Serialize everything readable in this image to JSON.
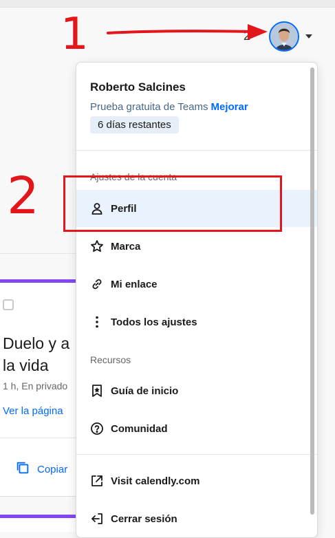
{
  "header": {
    "count_label": "2",
    "avatar_alt": "Roberto Salcines"
  },
  "annotations": {
    "step1": "1",
    "step2": "2"
  },
  "event_card": {
    "title": "Duelo y a\nla vida",
    "meta": "1 h, En privado",
    "view_link": "Ver la página",
    "copy_label": "Copiar"
  },
  "menu": {
    "user_name": "Roberto Salcines",
    "trial_text": "Prueba gratuita de Teams",
    "upgrade_label": "Mejorar",
    "days_left": "6 días restantes",
    "account_section": "Ajustes de la cuenta",
    "items": [
      {
        "label": "Perfil",
        "icon": "person-icon"
      },
      {
        "label": "Marca",
        "icon": "star-icon"
      },
      {
        "label": "Mi enlace",
        "icon": "link-icon"
      },
      {
        "label": "Todos los ajustes",
        "icon": "more-vertical-icon"
      }
    ],
    "resources_section": "Recursos",
    "resources": [
      {
        "label": "Guía de inicio",
        "icon": "bookmark-star-icon"
      },
      {
        "label": "Comunidad",
        "icon": "help-circle-icon"
      }
    ],
    "footer_items": [
      {
        "label": "Visit calendly.com",
        "icon": "external-link-icon"
      },
      {
        "label": "Cerrar sesión",
        "icon": "logout-icon"
      }
    ]
  },
  "colors": {
    "accent": "#0069ff",
    "annotation": "#e3161b",
    "card_stripe": "#8247f5",
    "active_item_bg": "#e9f2fd"
  }
}
